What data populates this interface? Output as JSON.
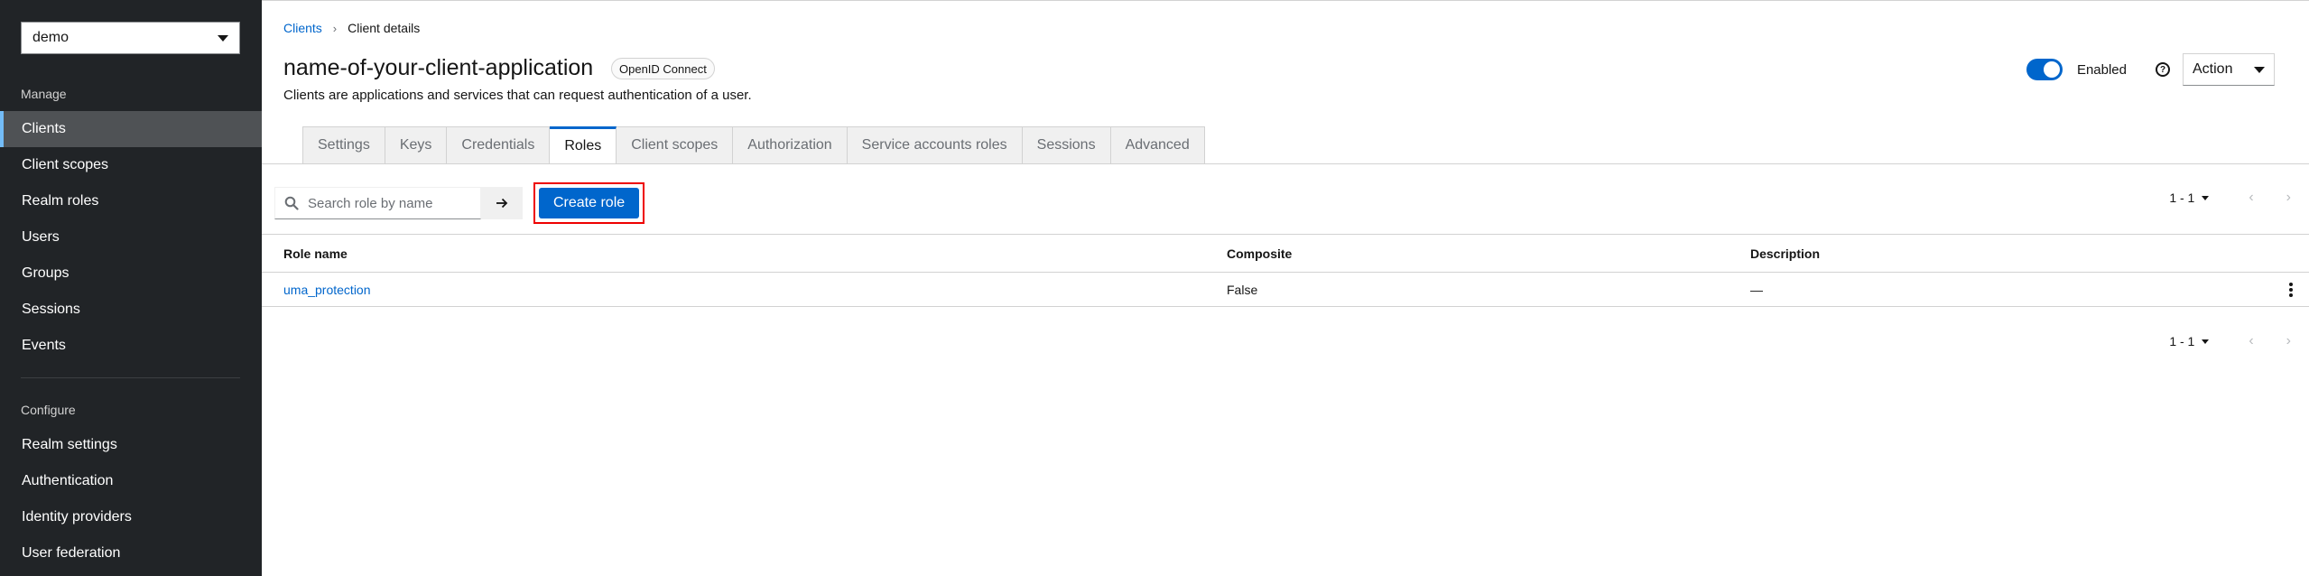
{
  "sidebar": {
    "realm": "demo",
    "manage_title": "Manage",
    "manage_items": [
      "Clients",
      "Client scopes",
      "Realm roles",
      "Users",
      "Groups",
      "Sessions",
      "Events"
    ],
    "configure_title": "Configure",
    "configure_items": [
      "Realm settings",
      "Authentication",
      "Identity providers",
      "User federation"
    ]
  },
  "breadcrumb": {
    "parent": "Clients",
    "current": "Client details"
  },
  "header": {
    "title": "name-of-your-client-application",
    "badge": "OpenID Connect",
    "description": "Clients are applications and services that can request authentication of a user.",
    "enabled_label": "Enabled",
    "enabled": true,
    "help_icon": "?",
    "action_label": "Action"
  },
  "tabs": [
    "Settings",
    "Keys",
    "Credentials",
    "Roles",
    "Client scopes",
    "Authorization",
    "Service accounts roles",
    "Sessions",
    "Advanced"
  ],
  "active_tab": "Roles",
  "toolbar": {
    "search_placeholder": "Search role by name",
    "create_label": "Create role"
  },
  "pagination": {
    "range": "1 - 1",
    "prev": "‹",
    "next": "›"
  },
  "table": {
    "headers": {
      "name": "Role name",
      "composite": "Composite",
      "description": "Description"
    },
    "rows": [
      {
        "name": "uma_protection",
        "composite": "False",
        "description": "—"
      }
    ]
  },
  "colors": {
    "accent": "#0066cc",
    "sidebar_bg": "#212427",
    "highlight": "#e00000"
  }
}
